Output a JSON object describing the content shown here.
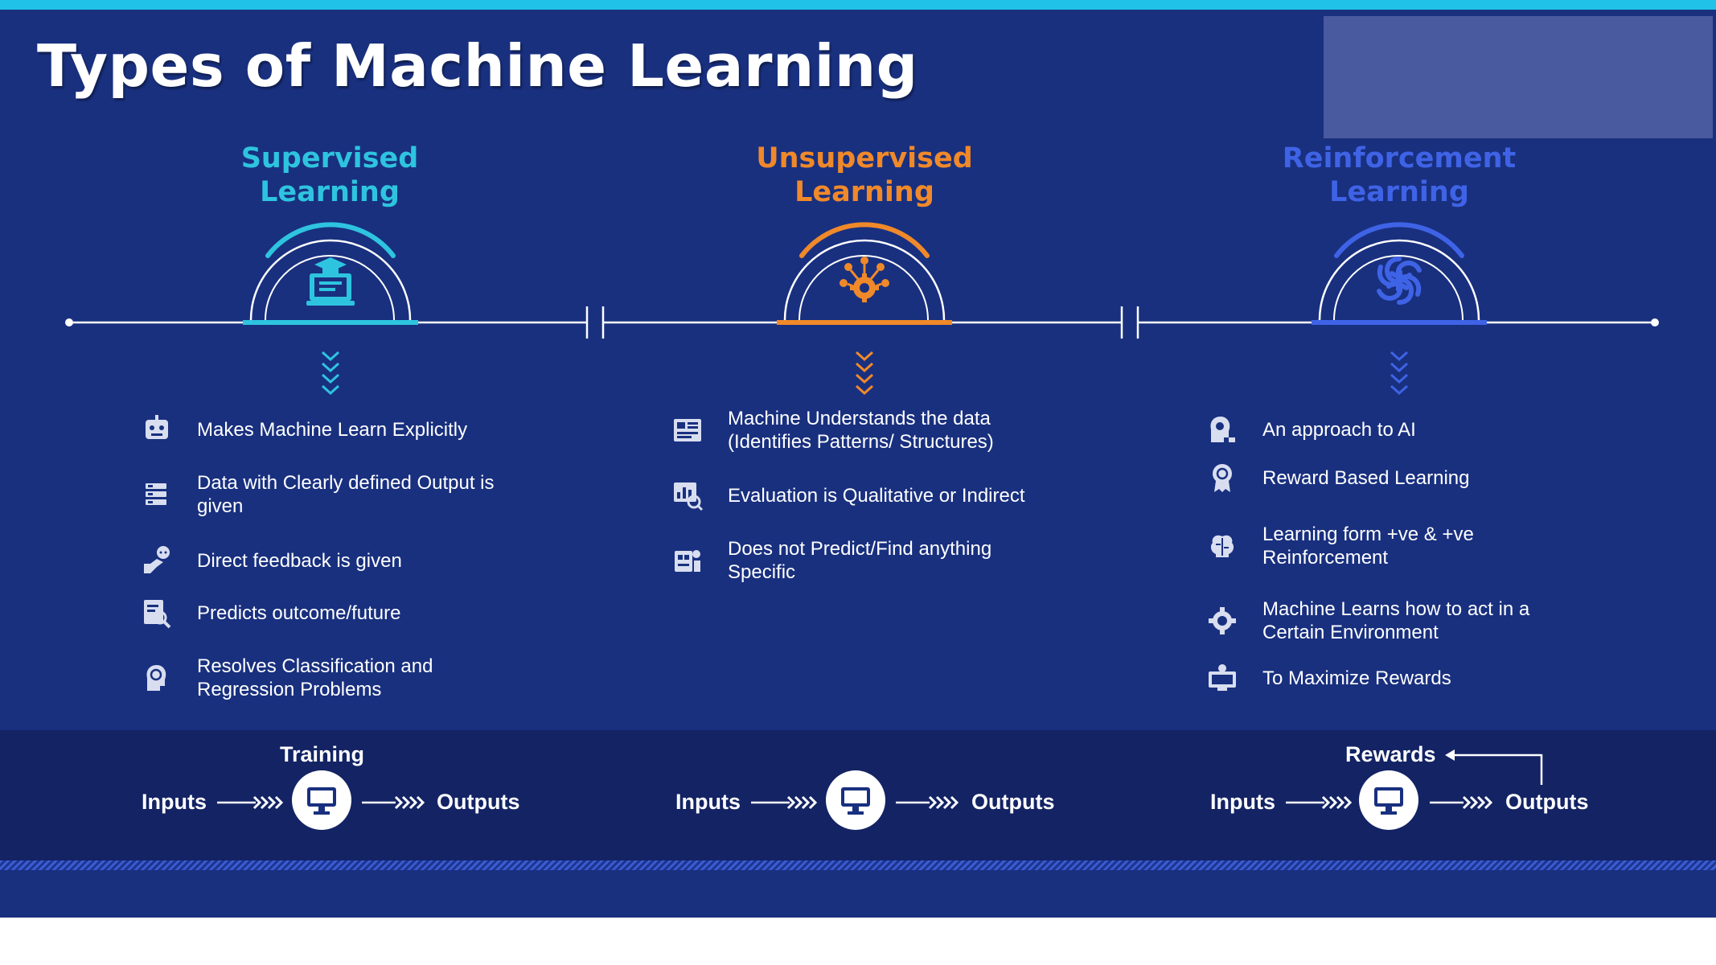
{
  "title": "Types of Machine Learning",
  "colors": {
    "background": "#19307f",
    "bottom_band": "#132364",
    "accent_top": "#21c2e8",
    "supervised": "#2ec4df",
    "unsupervised": "#f0892a",
    "reinforcement": "#3f63e6"
  },
  "columns": [
    {
      "title_line1": "Supervised",
      "title_line2": "Learning",
      "icon": "graduate-computer-icon",
      "features": [
        {
          "icon": "robot-head-icon",
          "text": "Makes Machine Learn Explicitly"
        },
        {
          "icon": "database-icon",
          "text": "Data with Clearly defined Output is\ngiven"
        },
        {
          "icon": "feedback-hand-icon",
          "text": "Direct feedback is given"
        },
        {
          "icon": "search-document-icon",
          "text": "Predicts outcome/future"
        },
        {
          "icon": "brain-head-icon",
          "text": "Resolves Classification and\nRegression Problems"
        }
      ]
    },
    {
      "title_line1": "Unsupervised",
      "title_line2": "Learning",
      "icon": "gear-network-icon",
      "features": [
        {
          "icon": "dashboard-icon",
          "text": "Machine Understands the data\n(Identifies Patterns/ Structures)"
        },
        {
          "icon": "evaluation-chart-icon",
          "text": "Evaluation is Qualitative or Indirect"
        },
        {
          "icon": "robot-chip-icon",
          "text": "Does not Predict/Find anything\nSpecific"
        }
      ]
    },
    {
      "title_line1": "Reinforcement",
      "title_line2": "Learning",
      "icon": "knot-logo-icon",
      "features": [
        {
          "icon": "ai-head-icon",
          "text": "An approach to AI"
        },
        {
          "icon": "award-badge-icon",
          "text": "Reward Based Learning"
        },
        {
          "icon": "brain-book-icon",
          "text": "Learning form +ve & +ve\nReinforcement"
        },
        {
          "icon": "gear-brain-icon",
          "text": "Machine Learns how to act in a\nCertain Environment"
        },
        {
          "icon": "monitor-user-icon",
          "text": "To Maximize Rewards"
        }
      ]
    }
  ],
  "flows": [
    {
      "top_label": "Training",
      "inputs": "Inputs",
      "outputs": "Outputs"
    },
    {
      "top_label": "",
      "inputs": "Inputs",
      "outputs": "Outputs"
    },
    {
      "top_label": "Rewards",
      "inputs": "Inputs",
      "outputs": "Outputs"
    }
  ]
}
